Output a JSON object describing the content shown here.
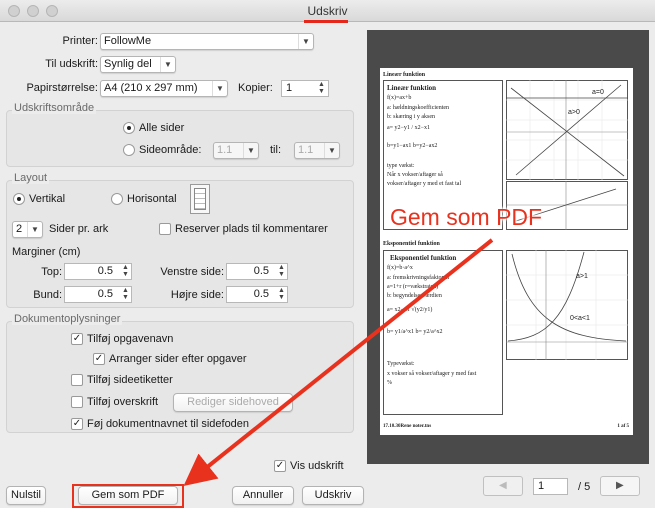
{
  "window": {
    "title": "Udskriv",
    "accent_color": "#e8321e"
  },
  "settings": {
    "printer_label": "Printer:",
    "printer_value": "FollowMe",
    "presets_label": "Til udskrift:",
    "presets_value": "Synlig del",
    "paper_label": "Papirstørrelse:",
    "paper_value": "A4 (210 x 297 mm)",
    "copies_label": "Kopier:",
    "copies_value": "1"
  },
  "print_range": {
    "title": "Udskriftsområde",
    "all_pages": "Alle sider",
    "page_range": "Sideområde:",
    "from_value": "1.1",
    "to_label": "til:",
    "to_value": "1.1"
  },
  "layout": {
    "title": "Layout",
    "portrait": "Vertikal",
    "landscape": "Horisontal",
    "pages_per_sheet_value": "2",
    "pages_per_sheet_label": "Sider pr. ark",
    "reserve_label": "Reserver plads til kommentarer",
    "margins_label": "Marginer (cm)",
    "top_label": "Top:",
    "top_value": "0.5",
    "left_label": "Venstre side:",
    "left_value": "0.5",
    "bottom_label": "Bund:",
    "bottom_value": "0.5",
    "right_label": "Højre side:",
    "right_value": "0.5"
  },
  "doc_info": {
    "title": "Dokumentoplysninger",
    "add_task_name": "Tilføj opgavenavn",
    "arrange_pages": "Arranger sider efter opgaver",
    "add_page_labels": "Tilføj sideetiketter",
    "add_header": "Tilføj overskrift",
    "edit_header_button": "Rediger sidehoved",
    "add_doc_name": "Føj dokumentnavnet til sidefoden"
  },
  "show_print": "Vis udskrift",
  "buttons": {
    "reset": "Nulstil",
    "save_pdf": "Gem som PDF",
    "cancel": "Annuller",
    "print": "Udskriv"
  },
  "pager": {
    "current": "1",
    "total": "/ 5"
  },
  "annotation": {
    "label": "Gem som PDF"
  },
  "preview": {
    "section1_header": "Lineær funktion",
    "s1_title": "Lineær funktion",
    "s1_lines": [
      "f(x)=ax+b",
      "a: hældningskoefficienten",
      "b: skæring i y aksen",
      "a= y2−y1 / x2−x1",
      "b=y1−ax1   b=y2−ax2",
      "",
      "type vækst:",
      "Når x vokser/aftager så",
      "vokser/aftager y med et fast tal"
    ],
    "s1_graph_labels": [
      "a=0",
      "a>0"
    ],
    "section2_header": "Eksponentiel funktion",
    "s2_title": "Eksponentiel funktion",
    "s2_lines": [
      "f(x)=b·a^x",
      "a: fremskrivningsfaktoren",
      "a=1+r (r=vækstraten)",
      "b: begyndelsesværdien",
      "a= x2−x1 √(y2/y1)",
      "b= y1/a^x1   b= y2/a^x2",
      "",
      "Typevækst:",
      "x vokser så vokser/aftager y med fast",
      "%"
    ],
    "s2_graph_labels": [
      "a>1",
      "0<a<1"
    ],
    "footer_left": "17.10.30Rene noter.tns",
    "footer_right": "1 af 5"
  }
}
